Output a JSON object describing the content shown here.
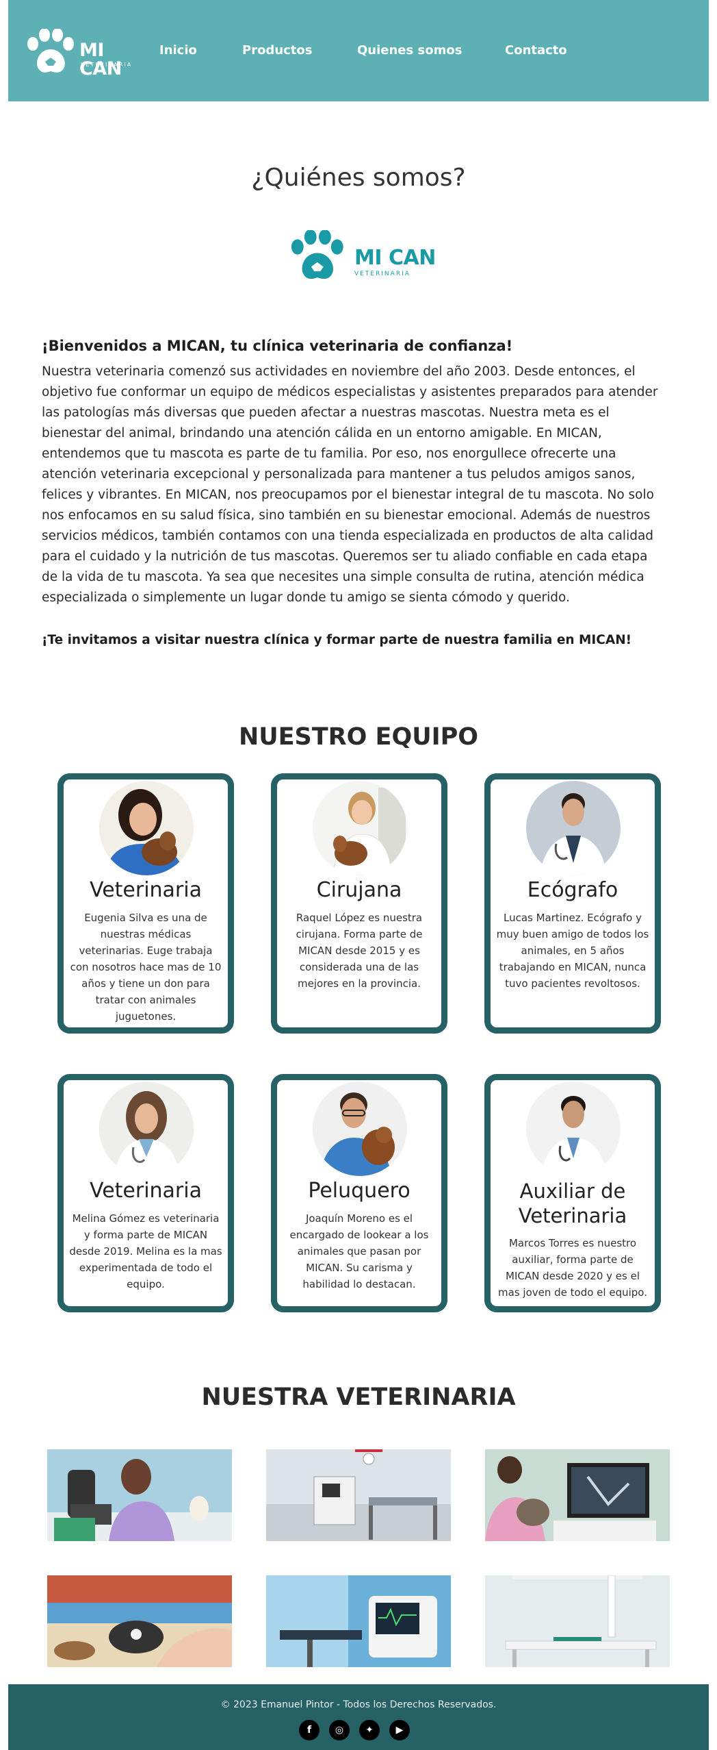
{
  "brand": {
    "name": "MI CAN",
    "subtitle": "VETERINARIA"
  },
  "nav": {
    "links": [
      "Inicio",
      "Productos",
      "Quienes somos",
      "Contacto"
    ]
  },
  "about": {
    "title": "¿Quiénes somos?",
    "welcome": "¡Bienvenidos a MICAN, tu clínica veterinaria de confianza!",
    "intro": "Nuestra veterinaria comenzó sus actividades en noviembre del año 2003. Desde entonces, el objetivo fue conformar un equipo de médicos especialistas y asistentes preparados para atender las patologías más diversas que pueden afectar a nuestras mascotas. Nuestra meta es el bienestar del animal, brindando una atención cálida en un entorno amigable. En MICAN, entendemos que tu mascota es parte de tu familia. Por eso, nos enorgullece ofrecerte una atención veterinaria excepcional y personalizada para mantener a tus peludos amigos sanos, felices y vibrantes. En MICAN, nos preocupamos por el bienestar integral de tu mascota. No solo nos enfocamos en su salud física, sino también en su bienestar emocional. Además de nuestros servicios médicos, también contamos con una tienda especializada en productos de alta calidad para el cuidado y la nutrición de tus mascotas. Queremos ser tu aliado confiable en cada etapa de la vida de tu mascota. Ya sea que necesites una simple consulta de rutina, atención médica especializada o simplemente un lugar donde tu amigo se sienta cómodo y querido.",
    "invite": "¡Te invitamos a visitar nuestra clínica y formar parte de nuestra familia en MICAN!"
  },
  "team": {
    "title": "NUESTRO EQUIPO",
    "members": [
      {
        "role": "Veterinaria",
        "desc": "Eugenia Silva es una de nuestras médicas veterinarias. Euge trabaja con nosotros hace mas de 10 años y tiene un don para tratar con animales juguetones."
      },
      {
        "role": "Cirujana",
        "desc": "Raquel López es nuestra cirujana. Forma parte de MICAN desde 2015 y es considerada una de las mejores en la provincia."
      },
      {
        "role": "Ecógrafo",
        "desc": "Lucas Martinez. Ecógrafo y muy buen amigo de todos los animales, en 5 años trabajando en MICAN, nunca tuvo pacientes revoltosos."
      },
      {
        "role": "Veterinaria",
        "desc": "Melina Gómez es veterinaria y forma parte de MICAN desde 2019. Melina es la mas experimentada de todo el equipo."
      },
      {
        "role": "Peluquero",
        "desc": "Joaquín Moreno es el encargado de lookear a los animales que pasan por MICAN. Su carisma y habilidad lo destacan."
      },
      {
        "role": "Auxiliar de Veterinaria",
        "desc": "Marcos Torres es nuestro auxiliar, forma parte de MICAN desde 2020 y es el mas joven de todo el equipo."
      }
    ]
  },
  "clinic": {
    "title": "NUESTRA VETERINARIA"
  },
  "footer": {
    "copyright": "© 2023 Emanuel Pintor - Todos los Derechos Reservados.",
    "social": [
      {
        "icon": "facebook-icon",
        "glyph": "f"
      },
      {
        "icon": "instagram-icon",
        "glyph": "◎"
      },
      {
        "icon": "twitter-icon",
        "glyph": "✦"
      },
      {
        "icon": "youtube-icon",
        "glyph": "▶"
      }
    ]
  },
  "colors": {
    "nav": "#5db1b4",
    "accent": "#1a9aa6",
    "card_border": "#256165",
    "footer": "#256165"
  }
}
